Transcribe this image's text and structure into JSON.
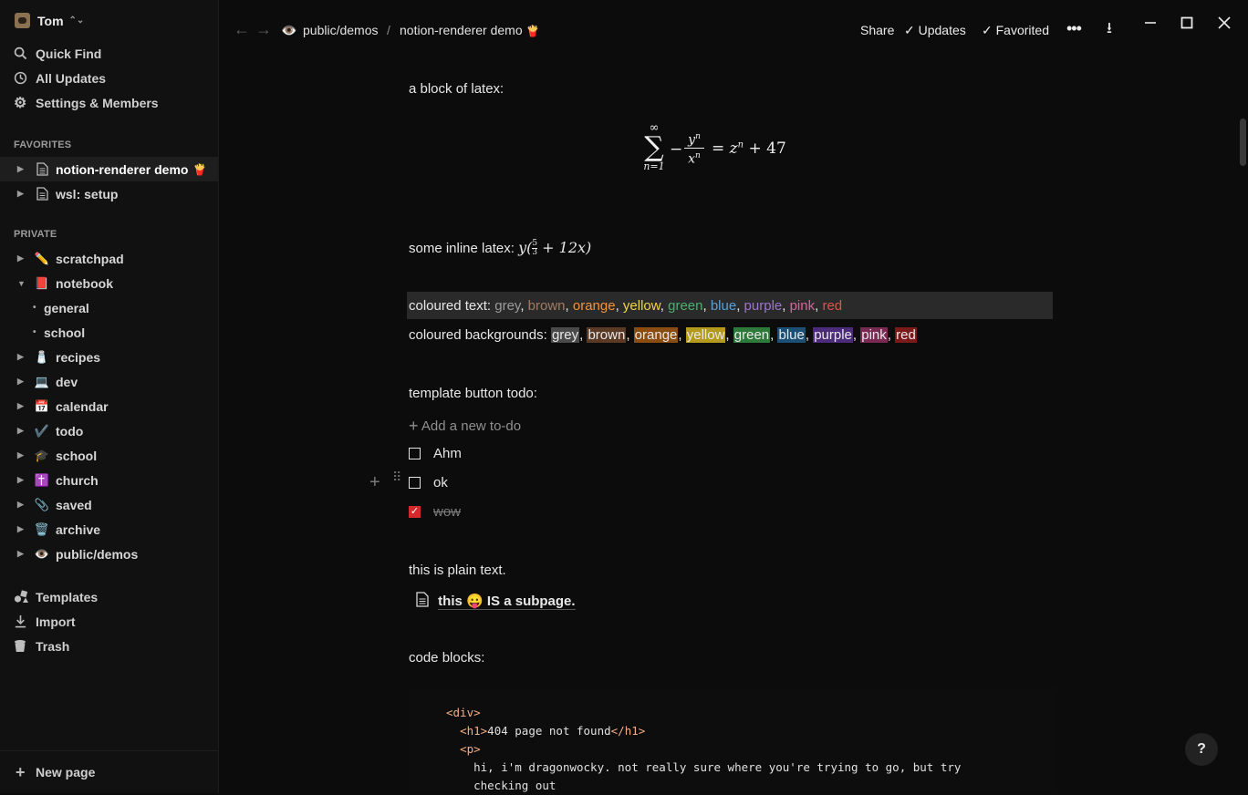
{
  "workspace": {
    "name": "Tom"
  },
  "sidebar": {
    "quick_find": "Quick Find",
    "all_updates": "All Updates",
    "settings": "Settings & Members",
    "favorites_label": "FAVORITES",
    "favorites": [
      {
        "label": "notion-renderer demo",
        "suffix": "🍟"
      },
      {
        "label": "wsl: setup"
      }
    ],
    "private_label": "PRIVATE",
    "private": [
      {
        "label": "scratchpad",
        "emoji": "✏️"
      },
      {
        "label": "notebook",
        "emoji": "📕"
      },
      {
        "label": "general"
      },
      {
        "label": "school"
      },
      {
        "label": "recipes",
        "emoji": "🧂"
      },
      {
        "label": "dev",
        "emoji": "💻"
      },
      {
        "label": "calendar",
        "emoji": "📅"
      },
      {
        "label": "todo",
        "emoji": "✔️"
      },
      {
        "label": "school",
        "emoji": "🎓"
      },
      {
        "label": "church",
        "emoji": "✝️"
      },
      {
        "label": "saved",
        "emoji": "📎"
      },
      {
        "label": "archive",
        "emoji": "🗑️"
      },
      {
        "label": "public/demos",
        "emoji": "👁️"
      }
    ],
    "templates": "Templates",
    "import": "Import",
    "trash": "Trash",
    "new_page": "New page"
  },
  "topbar": {
    "breadcrumb_1": "public/demos",
    "breadcrumb_sep": "/",
    "breadcrumb_2": "notion-renderer demo",
    "breadcrumb_2_emoji": "🍟",
    "share": "Share",
    "updates": "Updates",
    "favorited": "Favorited"
  },
  "content": {
    "latex_block_label": "a block of latex:",
    "inline_latex_label": "some inline latex:",
    "coloured_text_label": "coloured text:",
    "colors": [
      "grey",
      "brown",
      "orange",
      "yellow",
      "green",
      "blue",
      "purple",
      "pink",
      "red"
    ],
    "text_colors": [
      "#9b9b9b",
      "#a27b63",
      "#f0943b",
      "#f3d54a",
      "#4fae70",
      "#5aa0d6",
      "#9e73cf",
      "#d5649c",
      "#e0534d"
    ],
    "bg_colors": [
      "#4a4a4a",
      "#5a3a25",
      "#8a4c10",
      "#b39a1c",
      "#2e7a3a",
      "#1c4f74",
      "#4c2c7a",
      "#7a2a52",
      "#7a1a1a"
    ],
    "coloured_bg_label": "coloured backgrounds:",
    "template_label": "template button todo:",
    "add_todo": "Add a new to-do",
    "todos": [
      {
        "label": "Ahm",
        "checked": false
      },
      {
        "label": "ok",
        "checked": false
      },
      {
        "label": "wow",
        "checked": true
      }
    ],
    "plain_text": "this is plain text.",
    "subpage": {
      "before": "this",
      "emoji": "😛",
      "after": "IS a subpage."
    },
    "code_label": "code blocks:",
    "code": {
      "l1_tag": "<div>",
      "l2_open": "<h1>",
      "l2_text": "404 page not found",
      "l2_close": "</h1>",
      "l3_tag": "<p>",
      "l4": "hi, i'm dragonwocky. not really sure where you're trying to go, but try",
      "l5": "checking out"
    }
  },
  "help": "?"
}
